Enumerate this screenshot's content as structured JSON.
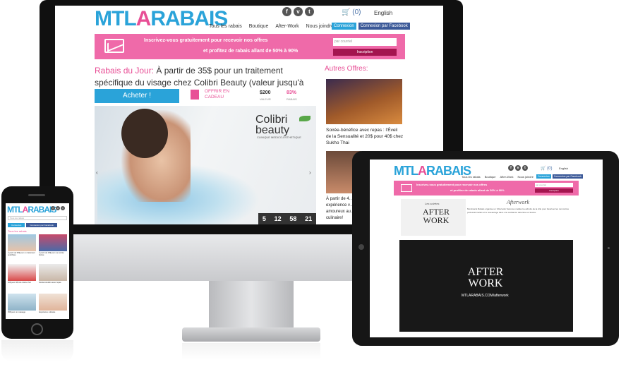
{
  "brand": {
    "logo_part1": "MTL",
    "logo_part2": "A",
    "logo_part3": "RABAIS"
  },
  "social": [
    "f",
    "v",
    "t"
  ],
  "desktop": {
    "cart": "(0)",
    "language": "English",
    "nav": [
      "Tous les rabais",
      "Boutique",
      "After-Work",
      "Nous joindre"
    ],
    "login": "Connexion",
    "login_facebook": "Connexion par Facebook",
    "banner_line1": "Inscrivez-vous gratuitement pour recevoir nos offres",
    "banner_line2": "et profitez de rabais allant de 50% à 90%",
    "email_placeholder": "par courriel",
    "subscribe": "Inscription",
    "deal_label": "Rabais du Jour:",
    "deal_text": "À partir de 35$ pour un traitement spécifique du visage chez Colibri Beauty (valeur jusqu'à 600$)",
    "buy": "Acheter !",
    "gift": "OFFRIR EN CADEAU",
    "value_amount": "$200",
    "value_label": "VALEUR",
    "discount_amount": "83%",
    "discount_label": "RABAIS",
    "hero_brand": "Colibri beauty",
    "hero_brand_sub": "CLINIQUE MEDICO-ESTHETIQUE",
    "timer": [
      "5",
      "12",
      "58",
      "21"
    ],
    "other_title": "Autres Offres:",
    "other_offer_1": "Soirée-bénéfice avec repas : l'Éveil de la Sensualité et 20$ pour 40$ chez Sukho Thai",
    "other_offer_2": "À partir de 4… expérience v… amoureux au… culinaire!"
  },
  "tablet": {
    "aw_small": "Les soirées",
    "aw_big": "AFTER WORK",
    "aw_handwritten": "Afterwork",
    "paragraph": "Montréal à Rabais organise un 'Afterwork' dans les meilleurs endroits de la ville pour favoriser les rencontres professionnelles et le réseautage dans une ambiance détendue et festive.",
    "video_big": "AFTER WORK",
    "video_url": "MTLARABAIS.COM/afterwork"
  },
  "phone": {
    "search_placeholder": "Tous les rabais",
    "section": "Tous les rabais",
    "cards": [
      "À partir de 35$ pour un traitement spécifique",
      "À partir de 15$ pour une soirée festive",
      "20$ pour 40$ de cuisine thaï",
      "Soirée-bénéfice avec repas",
      "35$ pour un massage",
      "Expérience culinaire"
    ]
  },
  "colors": {
    "pink": "#e84f96",
    "blue": "#2aa3d9",
    "navy": "#3b5998"
  }
}
